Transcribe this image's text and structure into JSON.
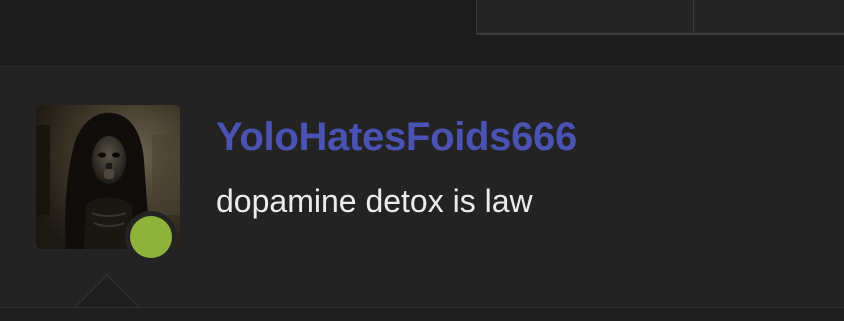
{
  "user": {
    "username": "YoloHatesFoids666",
    "status_text": "dopamine detox is law",
    "presence": "online",
    "avatar_icon": "user-avatar-image"
  },
  "colors": {
    "username": "#4a52b3",
    "online_indicator": "#8fb33a",
    "status_text": "#ececec",
    "background": "#232324"
  }
}
